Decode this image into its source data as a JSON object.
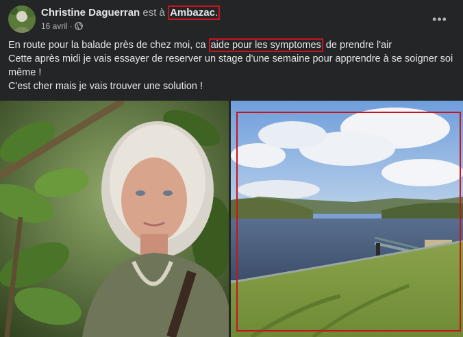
{
  "post": {
    "author": "Christine Daguerran",
    "location_prefix": "est à",
    "location": "Ambazac",
    "location_suffix": ".",
    "date": "16 avril",
    "separator": "·",
    "privacy_icon": "globe-icon",
    "more_icon": "more-horizontal-icon",
    "more_label": "•••",
    "text": {
      "line1_part1": "En route pour la balade près de chez moi, ca ",
      "line1_highlight": "aide pour les symptomes",
      "line1_part2": " de prendre l'air",
      "line2": "Cette après midi je vais essayer de reserver un stage d'une semaine pour apprendre à se soigner soi même !",
      "line3": "C'est cher mais je vais trouver une solution !"
    }
  },
  "colors": {
    "background": "#242526",
    "text_primary": "#e4e6eb",
    "text_secondary": "#b0b3b8",
    "highlight_border": "#c8141e"
  }
}
